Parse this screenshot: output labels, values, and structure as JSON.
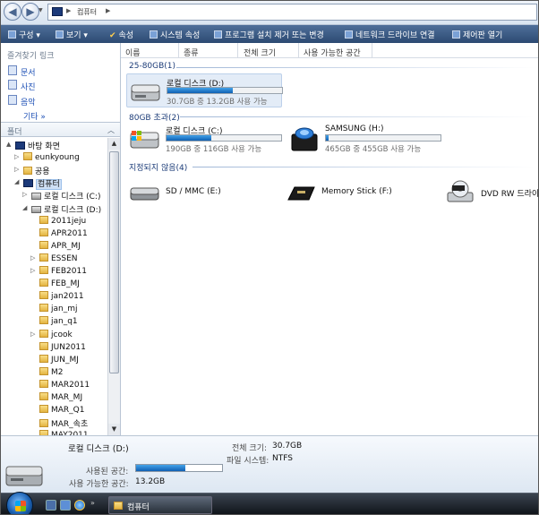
{
  "address": {
    "crumbs": [
      "컴퓨터"
    ]
  },
  "toolbar": {
    "items": [
      "구성",
      "보기",
      "속성",
      "시스템 속성",
      "프로그램 설치 제거 또는 변경",
      "네트워크 드라이브 연결",
      "제어판 열기"
    ]
  },
  "favorites": {
    "title": "즐겨찾기 링크",
    "items": [
      "문서",
      "사진",
      "음악"
    ],
    "more": "기타 »"
  },
  "folders": {
    "title": "폴더"
  },
  "tree": [
    {
      "label": "바탕 화면",
      "icon": "desktop-icon",
      "level": 0,
      "exp": "▲"
    },
    {
      "label": "eunkyoung",
      "icon": "user-folder-icon",
      "level": 1,
      "exp": "▷"
    },
    {
      "label": "공용",
      "icon": "folder-icon",
      "level": 1,
      "exp": "▷"
    },
    {
      "label": "컴퓨터",
      "icon": "computer-icon",
      "level": 1,
      "exp": "◢"
    },
    {
      "label": "로컬 디스크 (C:)",
      "icon": "drive-icon",
      "level": 2,
      "exp": "▷"
    },
    {
      "label": "로컬 디스크 (D:)",
      "icon": "drive-icon",
      "level": 2,
      "exp": "◢"
    },
    {
      "label": "2011jeju",
      "icon": "folder-icon",
      "level": 3
    },
    {
      "label": "APR2011",
      "icon": "folder-icon",
      "level": 3
    },
    {
      "label": "APR_MJ",
      "icon": "folder-icon",
      "level": 3
    },
    {
      "label": "ESSEN",
      "icon": "folder-icon",
      "level": 3,
      "exp": "▷"
    },
    {
      "label": "FEB2011",
      "icon": "folder-icon",
      "level": 3,
      "exp": "▷"
    },
    {
      "label": "FEB_MJ",
      "icon": "folder-icon",
      "level": 3
    },
    {
      "label": "jan2011",
      "icon": "folder-icon",
      "level": 3
    },
    {
      "label": "jan_mj",
      "icon": "folder-icon",
      "level": 3
    },
    {
      "label": "jan_q1",
      "icon": "folder-icon",
      "level": 3
    },
    {
      "label": "jcook",
      "icon": "folder-icon",
      "level": 3,
      "exp": "▷"
    },
    {
      "label": "JUN2011",
      "icon": "folder-icon",
      "level": 3
    },
    {
      "label": "JUN_MJ",
      "icon": "folder-icon",
      "level": 3
    },
    {
      "label": "M2",
      "icon": "folder-icon",
      "level": 3
    },
    {
      "label": "MAR2011",
      "icon": "folder-icon",
      "level": 3
    },
    {
      "label": "MAR_MJ",
      "icon": "folder-icon",
      "level": 3
    },
    {
      "label": "MAR_Q1",
      "icon": "folder-icon",
      "level": 3
    },
    {
      "label": "MAR_속초",
      "icon": "folder-icon",
      "level": 3
    },
    {
      "label": "MAY2011",
      "icon": "folder-icon",
      "level": 3
    }
  ],
  "columns": [
    "이름",
    "종류",
    "전체 크기",
    "사용 가능한 공간"
  ],
  "groups": {
    "g1": {
      "title": "25-80GB(1)",
      "items": [
        {
          "name": "로컬 디스크 (D:)",
          "free": "30.7GB 중 13.2GB 사용 가능",
          "used": 0.57
        }
      ]
    },
    "g2": {
      "title": "80GB 초과(2)",
      "items": [
        {
          "name": "로컬 디스크 (C:)",
          "free": "190GB 중 116GB 사용 가능",
          "used": 0.39
        },
        {
          "name": "SAMSUNG (H:)",
          "free": "465GB 중 455GB 사용 가능",
          "used": 0.02
        }
      ]
    },
    "g3": {
      "title": "지정되지 않음(4)",
      "items": [
        {
          "name": "SD / MMC (E:)",
          "icon": "removable-drive-icon"
        },
        {
          "name": "Memory Stick (F:)",
          "icon": "memory-stick-icon"
        },
        {
          "name": "DVD RW 드라이",
          "icon": "dvd-drive-icon"
        }
      ]
    }
  },
  "details": {
    "name": "로컬 디스크 (D:)",
    "used_label": "사용된 공간:",
    "free_label": "사용 가능한 공간:",
    "free_value": "13.2GB",
    "total_label": "전체 크기:",
    "total_value": "30.7GB",
    "fs_label": "파일 시스템:",
    "fs_value": "NTFS",
    "used": 0.57
  },
  "taskbar": {
    "window": "컴퓨터"
  }
}
